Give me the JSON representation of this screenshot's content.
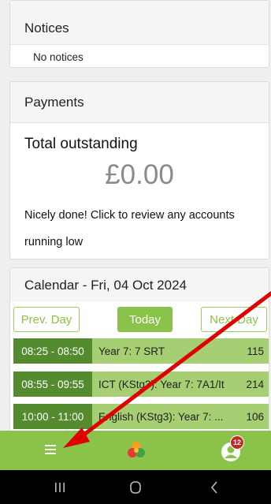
{
  "notices": {
    "title": "Notices",
    "empty_text": "No notices"
  },
  "payments": {
    "title": "Payments",
    "total_label": "Total outstanding",
    "amount": "£0.00",
    "message": "Nicely done! Click to review any accounts running low"
  },
  "calendar": {
    "title": "Calendar - Fri, 04 Oct 2024",
    "prev_label": "Prev. Day",
    "today_label": "Today",
    "next_label": "Next Day",
    "rows": [
      {
        "time": "08:25 - 08:50",
        "title": "Year 7: 7 SRT",
        "room": "115"
      },
      {
        "time": "08:55 - 09:55",
        "title": "ICT (KStg3): Year 7: 7A1/It",
        "room": "214"
      },
      {
        "time": "10:00 - 11:00",
        "title": "English (KStg3): Year 7: ...",
        "room": "106"
      }
    ]
  },
  "bottom_bar": {
    "badge_count": "12"
  },
  "colors": {
    "brand_green": "#8bc34a",
    "time_green": "#558b2f",
    "row_green": "#a5cf72",
    "badge_red": "#c62828",
    "arrow_red": "#e00000"
  },
  "icons": {
    "menu": "hamburger-icon",
    "logo": "clover-logo-icon",
    "profile": "user-icon"
  }
}
